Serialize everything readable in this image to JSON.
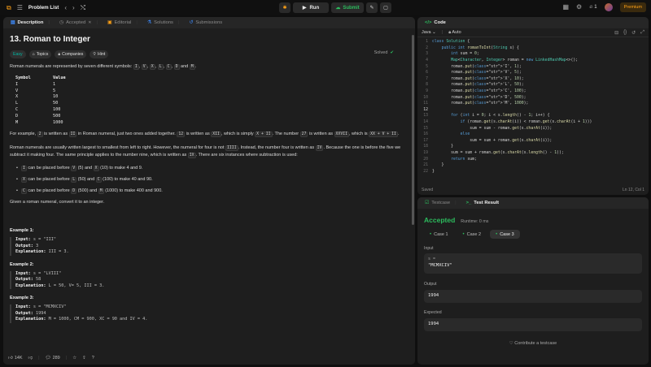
{
  "topbar": {
    "problem_list": "Problem List",
    "run_label": "Run",
    "submit_label": "Submit",
    "streak_count": "1",
    "premium_label": "Premium"
  },
  "left_tabs": [
    {
      "label": "Description"
    },
    {
      "label": "Accepted"
    },
    {
      "label": "Editorial"
    },
    {
      "label": "Solutions"
    },
    {
      "label": "Submissions"
    }
  ],
  "problem": {
    "title": "13. Roman to Integer",
    "status": "Solved",
    "tags": [
      "Easy",
      "Topics",
      "Companies",
      "Hint"
    ],
    "intro_pre": "Roman numerals are represented by seven different symbols:",
    "intro_symbols": [
      "I",
      "V",
      "X",
      "L",
      "C",
      "D",
      "M"
    ],
    "table_head": [
      "Symbol",
      "Value"
    ],
    "table_rows": [
      [
        "I",
        "1"
      ],
      [
        "V",
        "5"
      ],
      [
        "X",
        "10"
      ],
      [
        "L",
        "50"
      ],
      [
        "C",
        "100"
      ],
      [
        "D",
        "500"
      ],
      [
        "M",
        "1000"
      ]
    ],
    "para2": {
      "a": "For example,",
      "c1": "2",
      "b": "is written as",
      "c2": "II",
      "c": "in Roman numeral, just two ones added together.",
      "c3": "12",
      "d": "is written as",
      "c4": "XII",
      "e": ", which is simply",
      "c5": "X + II",
      "f": ". The number",
      "c6": "27",
      "g": "is written as",
      "c7": "XXVII",
      "h": ", which is",
      "c8": "XX + V + II",
      "i": "."
    },
    "para3": {
      "a": "Roman numerals are usually written largest to smallest from left to right. However, the numeral for four is not",
      "c1": "IIII",
      "b": ". Instead, the number four is written as",
      "c2": "IV",
      "c": ". Because the one is before the five we subtract it making four. The same principle applies to the number nine, which is written as",
      "c3": "IX",
      "d": ". There are six instances where subtraction is used:"
    },
    "bullets": [
      {
        "sym": "I",
        "a": "can be placed before",
        "s1": "V",
        "b": "(5) and",
        "s2": "X",
        "c": "(10) to make 4 and 9."
      },
      {
        "sym": "X",
        "a": "can be placed before",
        "s1": "L",
        "b": "(50) and",
        "s2": "C",
        "c": "(100) to make 40 and 90."
      },
      {
        "sym": "C",
        "a": "can be placed before",
        "s1": "D",
        "b": "(500) and",
        "s2": "M",
        "c": "(1000) to make 400 and 900."
      }
    ],
    "given": "Given a roman numeral, convert it to an integer.",
    "examples": [
      {
        "title": "Example 1:",
        "input": "s = \"III\"",
        "output": "3",
        "explanation": "III = 3."
      },
      {
        "title": "Example 2:",
        "input": "s = \"LVIII\"",
        "output": "58",
        "explanation": "L = 50, V= 5, III = 3."
      },
      {
        "title": "Example 3:",
        "input": "s = \"MCMXCIV\"",
        "output": "1994",
        "explanation": "M = 1000, CM = 900, XC = 90 and IV = 4."
      }
    ],
    "labels": {
      "input": "Input:",
      "output": "Output:",
      "explanation": "Explanation:"
    }
  },
  "left_footer": {
    "likes": "14K",
    "comments": "289"
  },
  "code_panel": {
    "title": "Code",
    "language": "Java",
    "mode": "Auto",
    "status": "Saved",
    "cursor": "Ln 12, Col 1",
    "current_line": 12,
    "lines": [
      "class Solution {",
      "    public int romanToInt(String s) {",
      "        int sum = 0;",
      "        Map<Character, Integer> roman = new LinkedHashMap<>();",
      "        roman.put('I', 1);",
      "        roman.put('V', 5);",
      "        roman.put('X', 10);",
      "        roman.put('L', 50);",
      "        roman.put('C', 100);",
      "        roman.put('D', 500);",
      "        roman.put('M', 1000);",
      "",
      "        for (int i = 0; i < s.length() - 1; i++) {",
      "            if (roman.get(s.charAt(i)) < roman.get(s.charAt(i + 1)))",
      "                sum = sum - roman.get(s.charAt(i));",
      "            else",
      "                sum = sum + roman.get(s.charAt(i));",
      "        }",
      "        sum = sum + roman.get(s.charAt(s.length() - 1));",
      "        return sum;",
      "    }",
      "}"
    ]
  },
  "result_panel": {
    "tab_testcase": "Testcase",
    "tab_result": "Test Result",
    "verdict": "Accepted",
    "runtime": "Runtime: 0 ms",
    "cases": [
      "Case 1",
      "Case 2",
      "Case 3"
    ],
    "active_case": 2,
    "input_label": "Input",
    "input_var": "s =",
    "input_value": "\"MCMXCIV\"",
    "output_label": "Output",
    "output_value": "1994",
    "expected_label": "Expected",
    "expected_value": "1994",
    "contribute": "Contribute a testcase"
  },
  "colors": {
    "accent_green": "#2cbb5d",
    "premium": "#ffa116",
    "easy": "#00b8a3",
    "panel": "#1e1e1e"
  }
}
